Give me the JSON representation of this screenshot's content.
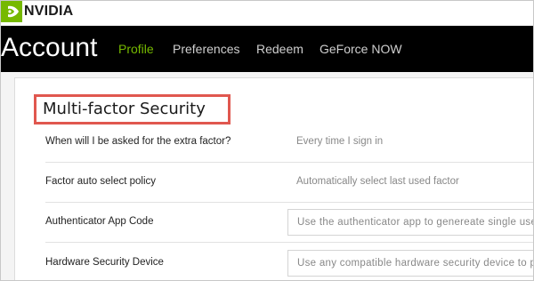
{
  "brand": {
    "name": "NVIDIA"
  },
  "nav": {
    "title": "Account",
    "tabs": [
      {
        "label": "Profile",
        "active": true
      },
      {
        "label": "Preferences",
        "active": false
      },
      {
        "label": "Redeem",
        "active": false
      },
      {
        "label": "GeForce NOW",
        "active": false
      }
    ],
    "active_color": "#76b900"
  },
  "section": {
    "title": "Multi-factor Security",
    "highlight_color": "#e0574f",
    "rows": [
      {
        "label": "When will I be asked for the extra factor?",
        "value": "Every time I sign in"
      },
      {
        "label": "Factor auto select policy",
        "value": "Automatically select last used factor"
      },
      {
        "label": "Authenticator App Code",
        "value": "Use the authenticator app to genereate single use..."
      },
      {
        "label": "Hardware Security Device",
        "value": "Use any compatible hardware security device to pr..."
      }
    ]
  }
}
